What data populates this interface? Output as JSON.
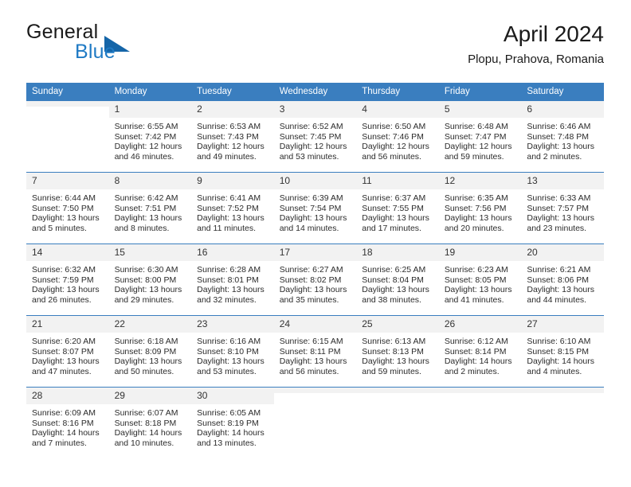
{
  "brand": {
    "word1": "General",
    "word2": "Blue",
    "triangle_color": "#1565a8",
    "blue_text_color": "#1f7ac4",
    "logo_icon": "triangle-icon"
  },
  "header": {
    "title": "April 2024",
    "location": "Plopu, Prahova, Romania"
  },
  "theme": {
    "header_bg": "#3a7ebf",
    "header_text": "#ffffff",
    "daynum_bg": "#f2f2f2",
    "grid_line": "#3a7ebf",
    "body_text": "#2b2b2b"
  },
  "weekday_headers": [
    "Sunday",
    "Monday",
    "Tuesday",
    "Wednesday",
    "Thursday",
    "Friday",
    "Saturday"
  ],
  "labels": {
    "sunrise_prefix": "Sunrise: ",
    "sunset_prefix": "Sunset: ",
    "daylight_prefix": "Daylight: "
  },
  "weeks": [
    [
      {
        "day": "",
        "empty": true
      },
      {
        "day": "1",
        "sunrise": "Sunrise: 6:55 AM",
        "sunset": "Sunset: 7:42 PM",
        "daylight_line1": "Daylight: 12 hours",
        "daylight_line2": "and 46 minutes."
      },
      {
        "day": "2",
        "sunrise": "Sunrise: 6:53 AM",
        "sunset": "Sunset: 7:43 PM",
        "daylight_line1": "Daylight: 12 hours",
        "daylight_line2": "and 49 minutes."
      },
      {
        "day": "3",
        "sunrise": "Sunrise: 6:52 AM",
        "sunset": "Sunset: 7:45 PM",
        "daylight_line1": "Daylight: 12 hours",
        "daylight_line2": "and 53 minutes."
      },
      {
        "day": "4",
        "sunrise": "Sunrise: 6:50 AM",
        "sunset": "Sunset: 7:46 PM",
        "daylight_line1": "Daylight: 12 hours",
        "daylight_line2": "and 56 minutes."
      },
      {
        "day": "5",
        "sunrise": "Sunrise: 6:48 AM",
        "sunset": "Sunset: 7:47 PM",
        "daylight_line1": "Daylight: 12 hours",
        "daylight_line2": "and 59 minutes."
      },
      {
        "day": "6",
        "sunrise": "Sunrise: 6:46 AM",
        "sunset": "Sunset: 7:48 PM",
        "daylight_line1": "Daylight: 13 hours",
        "daylight_line2": "and 2 minutes."
      }
    ],
    [
      {
        "day": "7",
        "sunrise": "Sunrise: 6:44 AM",
        "sunset": "Sunset: 7:50 PM",
        "daylight_line1": "Daylight: 13 hours",
        "daylight_line2": "and 5 minutes."
      },
      {
        "day": "8",
        "sunrise": "Sunrise: 6:42 AM",
        "sunset": "Sunset: 7:51 PM",
        "daylight_line1": "Daylight: 13 hours",
        "daylight_line2": "and 8 minutes."
      },
      {
        "day": "9",
        "sunrise": "Sunrise: 6:41 AM",
        "sunset": "Sunset: 7:52 PM",
        "daylight_line1": "Daylight: 13 hours",
        "daylight_line2": "and 11 minutes."
      },
      {
        "day": "10",
        "sunrise": "Sunrise: 6:39 AM",
        "sunset": "Sunset: 7:54 PM",
        "daylight_line1": "Daylight: 13 hours",
        "daylight_line2": "and 14 minutes."
      },
      {
        "day": "11",
        "sunrise": "Sunrise: 6:37 AM",
        "sunset": "Sunset: 7:55 PM",
        "daylight_line1": "Daylight: 13 hours",
        "daylight_line2": "and 17 minutes."
      },
      {
        "day": "12",
        "sunrise": "Sunrise: 6:35 AM",
        "sunset": "Sunset: 7:56 PM",
        "daylight_line1": "Daylight: 13 hours",
        "daylight_line2": "and 20 minutes."
      },
      {
        "day": "13",
        "sunrise": "Sunrise: 6:33 AM",
        "sunset": "Sunset: 7:57 PM",
        "daylight_line1": "Daylight: 13 hours",
        "daylight_line2": "and 23 minutes."
      }
    ],
    [
      {
        "day": "14",
        "sunrise": "Sunrise: 6:32 AM",
        "sunset": "Sunset: 7:59 PM",
        "daylight_line1": "Daylight: 13 hours",
        "daylight_line2": "and 26 minutes."
      },
      {
        "day": "15",
        "sunrise": "Sunrise: 6:30 AM",
        "sunset": "Sunset: 8:00 PM",
        "daylight_line1": "Daylight: 13 hours",
        "daylight_line2": "and 29 minutes."
      },
      {
        "day": "16",
        "sunrise": "Sunrise: 6:28 AM",
        "sunset": "Sunset: 8:01 PM",
        "daylight_line1": "Daylight: 13 hours",
        "daylight_line2": "and 32 minutes."
      },
      {
        "day": "17",
        "sunrise": "Sunrise: 6:27 AM",
        "sunset": "Sunset: 8:02 PM",
        "daylight_line1": "Daylight: 13 hours",
        "daylight_line2": "and 35 minutes."
      },
      {
        "day": "18",
        "sunrise": "Sunrise: 6:25 AM",
        "sunset": "Sunset: 8:04 PM",
        "daylight_line1": "Daylight: 13 hours",
        "daylight_line2": "and 38 minutes."
      },
      {
        "day": "19",
        "sunrise": "Sunrise: 6:23 AM",
        "sunset": "Sunset: 8:05 PM",
        "daylight_line1": "Daylight: 13 hours",
        "daylight_line2": "and 41 minutes."
      },
      {
        "day": "20",
        "sunrise": "Sunrise: 6:21 AM",
        "sunset": "Sunset: 8:06 PM",
        "daylight_line1": "Daylight: 13 hours",
        "daylight_line2": "and 44 minutes."
      }
    ],
    [
      {
        "day": "21",
        "sunrise": "Sunrise: 6:20 AM",
        "sunset": "Sunset: 8:07 PM",
        "daylight_line1": "Daylight: 13 hours",
        "daylight_line2": "and 47 minutes."
      },
      {
        "day": "22",
        "sunrise": "Sunrise: 6:18 AM",
        "sunset": "Sunset: 8:09 PM",
        "daylight_line1": "Daylight: 13 hours",
        "daylight_line2": "and 50 minutes."
      },
      {
        "day": "23",
        "sunrise": "Sunrise: 6:16 AM",
        "sunset": "Sunset: 8:10 PM",
        "daylight_line1": "Daylight: 13 hours",
        "daylight_line2": "and 53 minutes."
      },
      {
        "day": "24",
        "sunrise": "Sunrise: 6:15 AM",
        "sunset": "Sunset: 8:11 PM",
        "daylight_line1": "Daylight: 13 hours",
        "daylight_line2": "and 56 minutes."
      },
      {
        "day": "25",
        "sunrise": "Sunrise: 6:13 AM",
        "sunset": "Sunset: 8:13 PM",
        "daylight_line1": "Daylight: 13 hours",
        "daylight_line2": "and 59 minutes."
      },
      {
        "day": "26",
        "sunrise": "Sunrise: 6:12 AM",
        "sunset": "Sunset: 8:14 PM",
        "daylight_line1": "Daylight: 14 hours",
        "daylight_line2": "and 2 minutes."
      },
      {
        "day": "27",
        "sunrise": "Sunrise: 6:10 AM",
        "sunset": "Sunset: 8:15 PM",
        "daylight_line1": "Daylight: 14 hours",
        "daylight_line2": "and 4 minutes."
      }
    ],
    [
      {
        "day": "28",
        "sunrise": "Sunrise: 6:09 AM",
        "sunset": "Sunset: 8:16 PM",
        "daylight_line1": "Daylight: 14 hours",
        "daylight_line2": "and 7 minutes."
      },
      {
        "day": "29",
        "sunrise": "Sunrise: 6:07 AM",
        "sunset": "Sunset: 8:18 PM",
        "daylight_line1": "Daylight: 14 hours",
        "daylight_line2": "and 10 minutes."
      },
      {
        "day": "30",
        "sunrise": "Sunrise: 6:05 AM",
        "sunset": "Sunset: 8:19 PM",
        "daylight_line1": "Daylight: 14 hours",
        "daylight_line2": "and 13 minutes."
      },
      {
        "day": "",
        "empty": true
      },
      {
        "day": "",
        "empty": true
      },
      {
        "day": "",
        "empty": true
      },
      {
        "day": "",
        "empty": true
      }
    ]
  ]
}
